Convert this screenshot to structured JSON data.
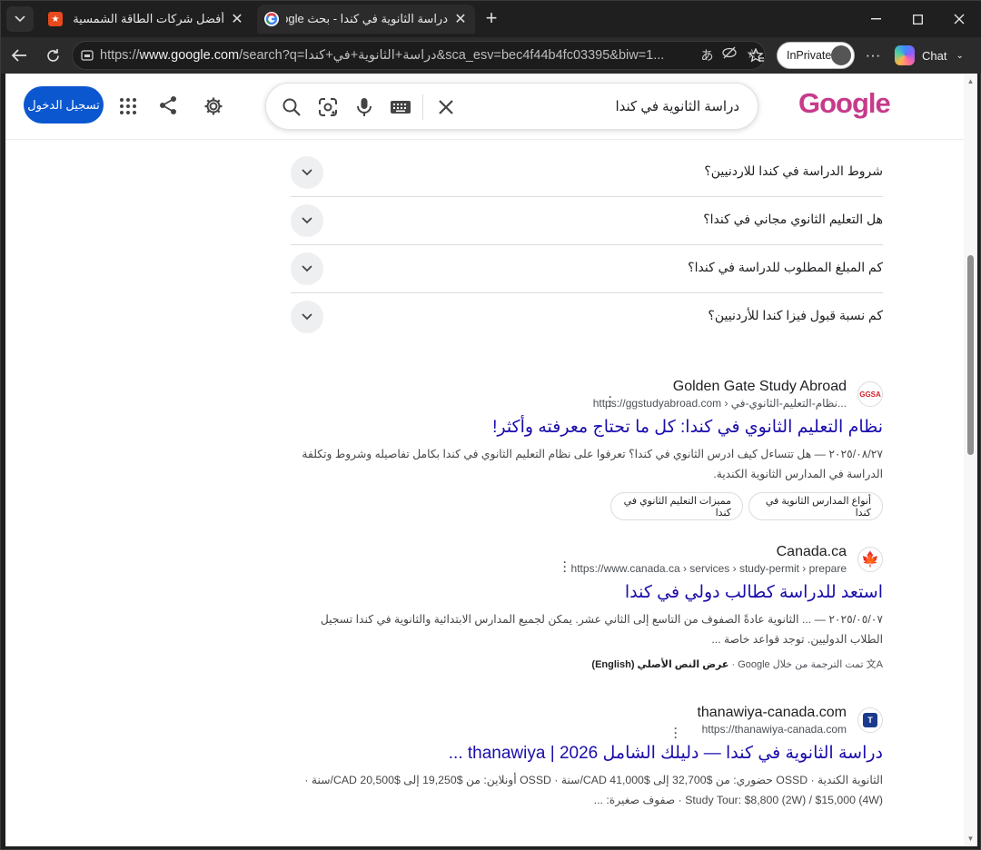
{
  "tabs": [
    {
      "title": "أفضل شركات الطاقة الشمسية في إر",
      "favicon_color": "#e8491d"
    },
    {
      "title": "دراسة الثانوية في كندا - بحث Google",
      "favicon_color": "#ffffff"
    }
  ],
  "address_bar": {
    "url_prefix": "https://",
    "url_host": "www.google.com",
    "url_rest": "/search?q=دراسة+الثانوية+في+كندا&sca_esv=bec4f44b4fc03395&biw=1..."
  },
  "toolbar": {
    "inprivate_label": "InPrivate",
    "chat_label": "Chat"
  },
  "google": {
    "signin_label": "تسجيل الدخول",
    "search_query": "دراسة الثانوية في كندا",
    "logo_text": "Google"
  },
  "paa": [
    "شروط الدراسة في كندا للاردنيين؟",
    "هل التعليم الثانوي مجاني في كندا؟",
    "كم المبلغ المطلوب للدراسة في كندا؟",
    "كم نسبة قبول فيزا كندا للأردنيين؟"
  ],
  "results": [
    {
      "site_name": "Golden Gate Study Abroad",
      "url": "https://ggstudyabroad.com › نظام-التعليم-الثانوي-في...",
      "favicon_text": "GGSA",
      "title": "نظام التعليم الثانوي في كندا: كل ما تحتاج معرفته وأكثر!",
      "snippet": "٢٠٢٥/٠٨/٢٧ — هل تتساءل كيف ادرس الثانوي في كندا؟ تعرفوا على نظام التعليم الثانوي في كندا بكامل تفاصيله وشروط وتكلفة الدراسة في المدارس الثانوية الكندية.",
      "chips": [
        "أنواع المدارس الثانوية في كندا",
        "مميزات التعليم الثانوي في كندا"
      ]
    },
    {
      "site_name": "Canada.ca",
      "url": "https://www.canada.ca › services › study-permit › prepare",
      "favicon_text": "🍁",
      "title": "استعد للدراسة كطالب دولي في كندا",
      "snippet": "٢٠٢٥/٠٥/٠٧ — ... الثانوية عادةً الصفوف من التاسع إلى الثاني عشر. يمكن لجميع المدارس الابتدائية والثانوية في كندا تسجيل الطلاب الدوليين. توجد قواعد خاصة ...",
      "translated_note": "تمت الترجمة من خلال Google",
      "view_original": "عرض النص الأصلي (English)"
    },
    {
      "site_name": "thanawiya-canada.com",
      "url": "https://thanawiya-canada.com",
      "favicon_text": "T",
      "title": "دراسة الثانوية في كندا — دليلك الشامل 2026 | thanawiya ...",
      "snippet": "الثانوية الكندية · OSSD حضوري: من $32,700 إلى $41,000 CAD/سنة · OSSD أونلاين: من $19,250 إلى $20,500 CAD/سنة · Study Tour: $8,800 (2W) / $15,000 (4W) · صفوف صغيرة: ..."
    }
  ],
  "colors": {
    "link": "#1a0dab",
    "signin_bg": "#0b57d0",
    "browser_chrome": "#1f1f1f"
  }
}
